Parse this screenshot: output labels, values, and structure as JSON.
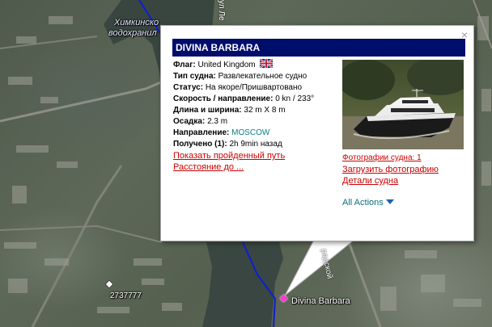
{
  "map": {
    "reservoir_label_line1": "Химкинско",
    "reservoir_label_line2": "водохранил",
    "street_label_top": "ул Ле",
    "street_label_right": "радской",
    "point_label": "2737777",
    "vessel_label": "Divina Barbara",
    "colors": {
      "route": "#0a1fd6",
      "vessel_marker": "#ff3ad6"
    }
  },
  "popup": {
    "title": "DIVINA BARBARA",
    "close_symbol": "×",
    "flag_label": "Флаг:",
    "flag_value": "United Kingdom",
    "flag_icon": "uk-flag-icon",
    "type_label": "Тип судна:",
    "type_value": "Развлекательное судно",
    "status_label": "Статус:",
    "status_value": "На якоре/Пришвартовано",
    "speed_label": "Скорость / направление:",
    "speed_value": "0 kn / 233°",
    "dimensions_label": "Длина и ширина:",
    "dimensions_value": "32 m X 8 m",
    "draught_label": "Осадка:",
    "draught_value": "2.3 m",
    "destination_label": "Направление:",
    "destination_value": "MOSCOW",
    "received_label": "Получено (1):",
    "received_value": "2h 9min назад",
    "track_link": "Показать пройденный путь",
    "distance_link": "Расстояние до ...",
    "photos_count_link": "Фотографии судна: 1",
    "upload_photo_link": "Загрузить фотографию",
    "vessel_details_link": "Детали судна",
    "all_actions": "All Actions",
    "colors": {
      "title_bar": "#000e6b",
      "link": "#cc0000",
      "teal": "#0a8080"
    }
  }
}
